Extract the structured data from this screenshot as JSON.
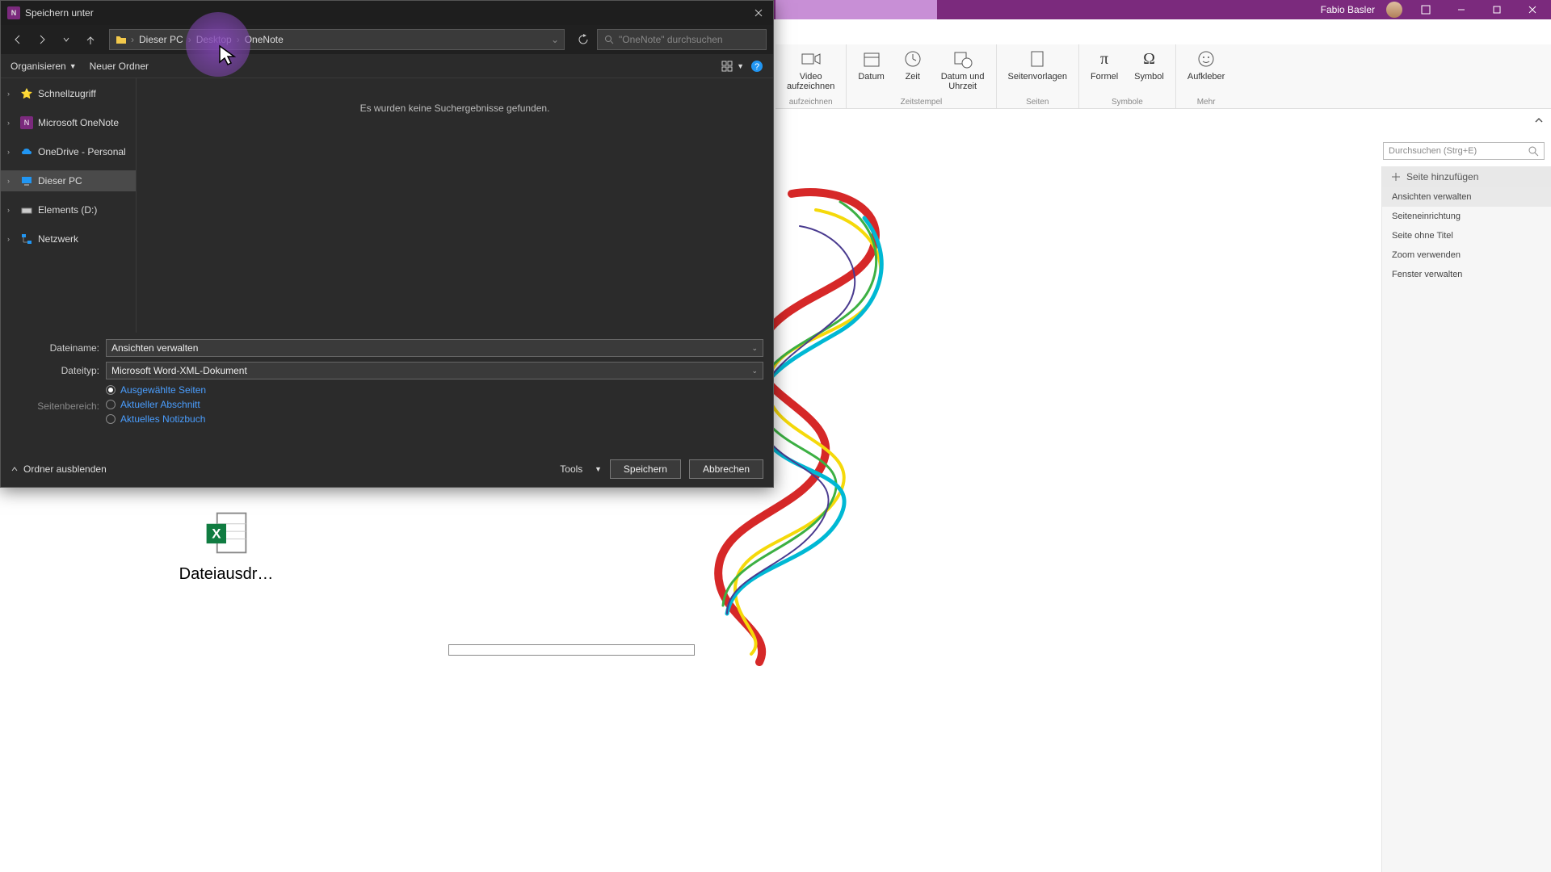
{
  "titlebar": {
    "user": "Fabio Basler"
  },
  "ribbon": {
    "groups": [
      {
        "label": "aufzeichnen",
        "buttons": [
          {
            "label": "Video\naufzeichnen"
          }
        ]
      },
      {
        "label": "Zeitstempel",
        "buttons": [
          {
            "label": "Datum"
          },
          {
            "label": "Zeit"
          },
          {
            "label": "Datum und\nUhrzeit"
          }
        ]
      },
      {
        "label": "Seiten",
        "buttons": [
          {
            "label": "Seitenvorlagen"
          }
        ]
      },
      {
        "label": "Symbole",
        "buttons": [
          {
            "label": "Formel"
          },
          {
            "label": "Symbol"
          }
        ]
      },
      {
        "label": "Mehr",
        "buttons": [
          {
            "label": "Aufkleber"
          }
        ]
      }
    ]
  },
  "rightpanel": {
    "search_placeholder": "Durchsuchen (Strg+E)",
    "add_page": "Seite hinzufügen",
    "items": [
      "Ansichten verwalten",
      "Seiteneinrichtung",
      "Seite ohne Titel",
      "Zoom verwenden",
      "Fenster verwalten"
    ]
  },
  "file_item": {
    "label": "Dateiausdr…"
  },
  "dialog": {
    "title": "Speichern unter",
    "breadcrumb": [
      "Dieser PC",
      "Desktop",
      "OneNote"
    ],
    "search_placeholder": "\"OneNote\" durchsuchen",
    "toolbar": {
      "organize": "Organisieren",
      "new_folder": "Neuer Ordner"
    },
    "tree": [
      {
        "label": "Schnellzugriff",
        "icon": "star",
        "color": "#f3c94b"
      },
      {
        "label": "Microsoft OneNote",
        "icon": "onenote",
        "color": "#7b2a7d"
      },
      {
        "label": "OneDrive - Personal",
        "icon": "cloud",
        "color": "#2196f3"
      },
      {
        "label": "Dieser PC",
        "icon": "pc",
        "color": "#2196f3",
        "selected": true
      },
      {
        "label": "Elements (D:)",
        "icon": "drive",
        "color": "#ccc"
      },
      {
        "label": "Netzwerk",
        "icon": "network",
        "color": "#2196f3"
      }
    ],
    "empty_msg": "Es wurden keine Suchergebnisse gefunden.",
    "filename_label": "Dateiname:",
    "filename_value": "Ansichten verwalten",
    "filetype_label": "Dateityp:",
    "filetype_value": "Microsoft Word-XML-Dokument",
    "range_label": "Seitenbereich:",
    "range_options": [
      "Ausgewählte Seiten",
      "Aktueller Abschnitt",
      "Aktuelles Notizbuch"
    ],
    "hide_folders": "Ordner ausblenden",
    "tools": "Tools",
    "save": "Speichern",
    "cancel": "Abbrechen"
  }
}
